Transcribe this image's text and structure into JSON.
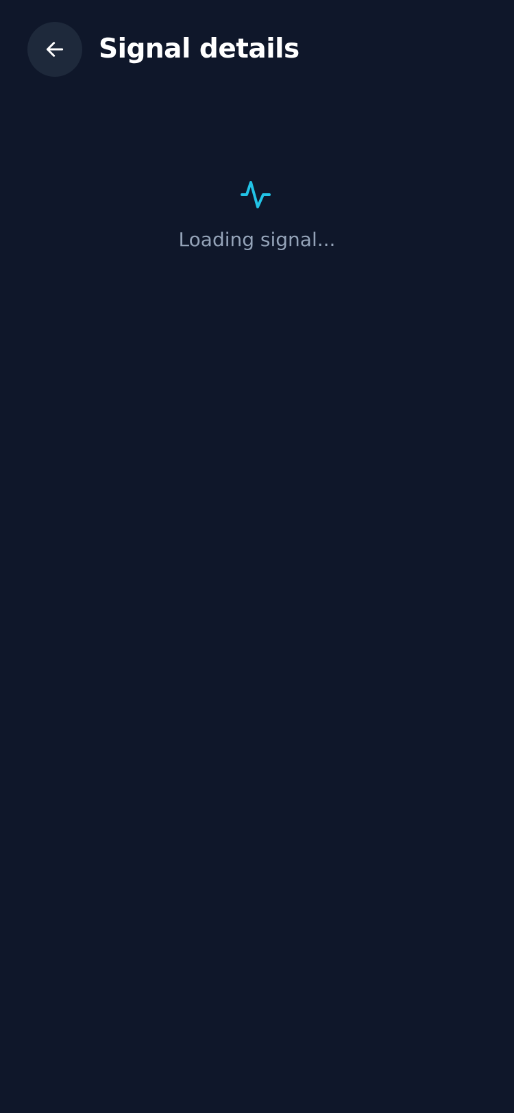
{
  "header": {
    "title": "Signal details",
    "back_icon": "arrow-left-icon"
  },
  "loading": {
    "icon": "activity-pulse-icon",
    "text": "Loading signal..."
  },
  "colors": {
    "background": "#0f172a",
    "back_button_bg": "#1e293b",
    "title": "#ffffff",
    "accent": "#22c3e6",
    "muted_text": "#94a3b8"
  }
}
